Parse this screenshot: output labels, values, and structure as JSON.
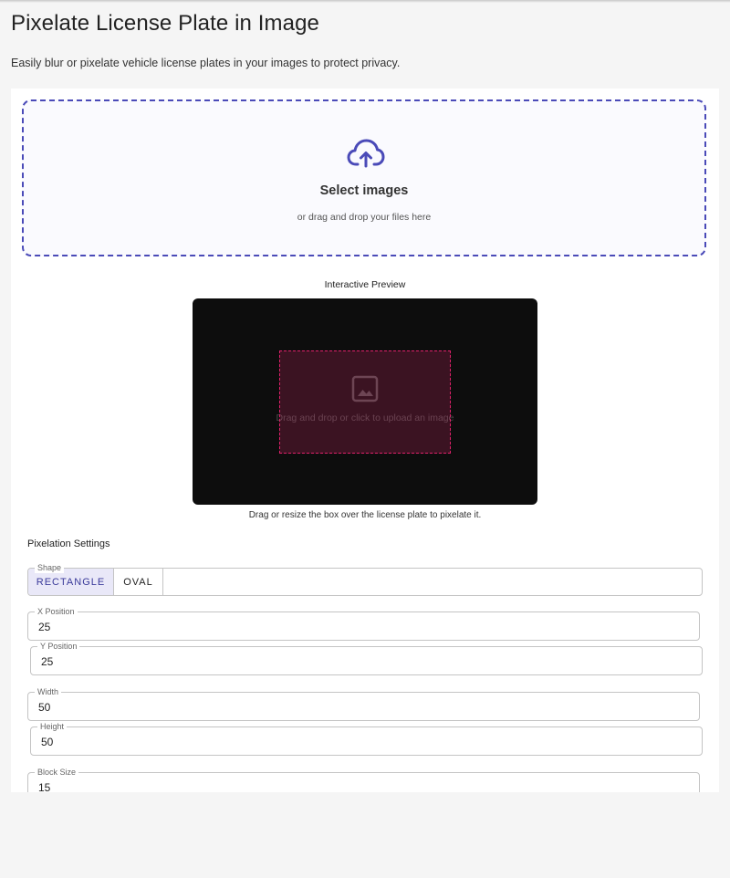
{
  "header": {
    "title": "Pixelate License Plate in Image",
    "subtitle": "Easily blur or pixelate vehicle license plates in your images to protect privacy."
  },
  "upload": {
    "icon": "cloud-upload-icon",
    "title": "Select images",
    "subtitle": "or drag and drop your files here",
    "accent_color": "#4a4ab8"
  },
  "preview": {
    "label": "Interactive Preview",
    "empty_icon": "image-icon",
    "empty_text": "Drag and drop or click to upload an image",
    "caption": "Drag or resize the box over the license plate to pixelate it.",
    "selection_color": "#e0206a"
  },
  "settings": {
    "title": "Pixelation Settings",
    "shape": {
      "label": "Shape",
      "options": [
        "RECTANGLE",
        "OVAL"
      ],
      "selected": "RECTANGLE"
    },
    "x_position": {
      "label": "X Position",
      "value": "25"
    },
    "y_position": {
      "label": "Y Position",
      "value": "25"
    },
    "width": {
      "label": "Width",
      "value": "50"
    },
    "height": {
      "label": "Height",
      "value": "50"
    },
    "block_size": {
      "label": "Block Size",
      "value": "15"
    }
  }
}
